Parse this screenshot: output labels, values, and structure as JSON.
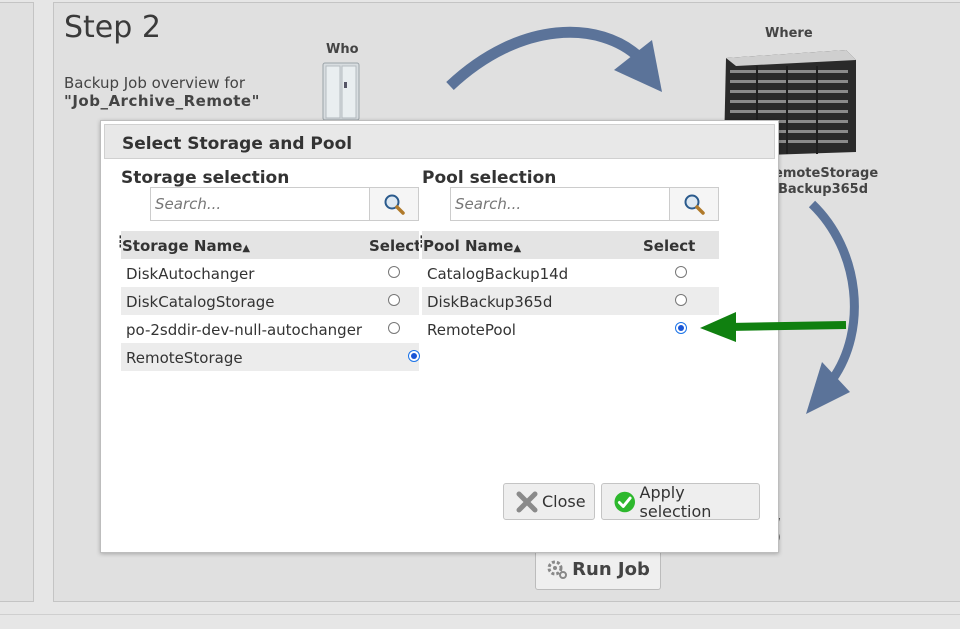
{
  "background": {
    "step_title": "Step 2",
    "overview_line1": "Backup Job overview for",
    "job_name_quoted": "\"Job_Archive_Remote\"",
    "who_label": "Who",
    "where_label": "Where",
    "storage_name_frag1": "emoteStorage",
    "storage_name_frag2": "Backup365d",
    "run_job_label": "Run Job"
  },
  "modal": {
    "title": "Select Storage and Pool",
    "storage_section_title": "Storage selection",
    "pool_section_title": "Pool selection",
    "storage_search": {
      "placeholder": "Search...",
      "value": ""
    },
    "pool_search": {
      "placeholder": "Search...",
      "value": ""
    },
    "storage_table": {
      "headers": {
        "name": "Storage Name",
        "select": "Select"
      },
      "rows": [
        {
          "name": "DiskAutochanger",
          "selected": false
        },
        {
          "name": "DiskCatalogStorage",
          "selected": false
        },
        {
          "name": "po-2sddir-dev-null-autochanger",
          "selected": false
        },
        {
          "name": "RemoteStorage",
          "selected": true
        }
      ]
    },
    "pool_table": {
      "headers": {
        "name": "Pool Name",
        "select": "Select"
      },
      "rows": [
        {
          "name": "CatalogBackup14d",
          "selected": false
        },
        {
          "name": "DiskBackup365d",
          "selected": false
        },
        {
          "name": "RemotePool",
          "selected": true
        }
      ]
    },
    "close_label": "Close",
    "apply_label": "Apply selection"
  },
  "colors": {
    "accent_blue": "#1a56d6",
    "arrow_blue": "#5b7399",
    "arrow_green": "#108010",
    "apply_icon_green": "#2db82d"
  },
  "icons": [
    "search-icon",
    "close-icon",
    "checkmark-icon",
    "gear-icon",
    "sort-asc-icon",
    "column-menu-icon",
    "server-icon",
    "tower-icon"
  ]
}
